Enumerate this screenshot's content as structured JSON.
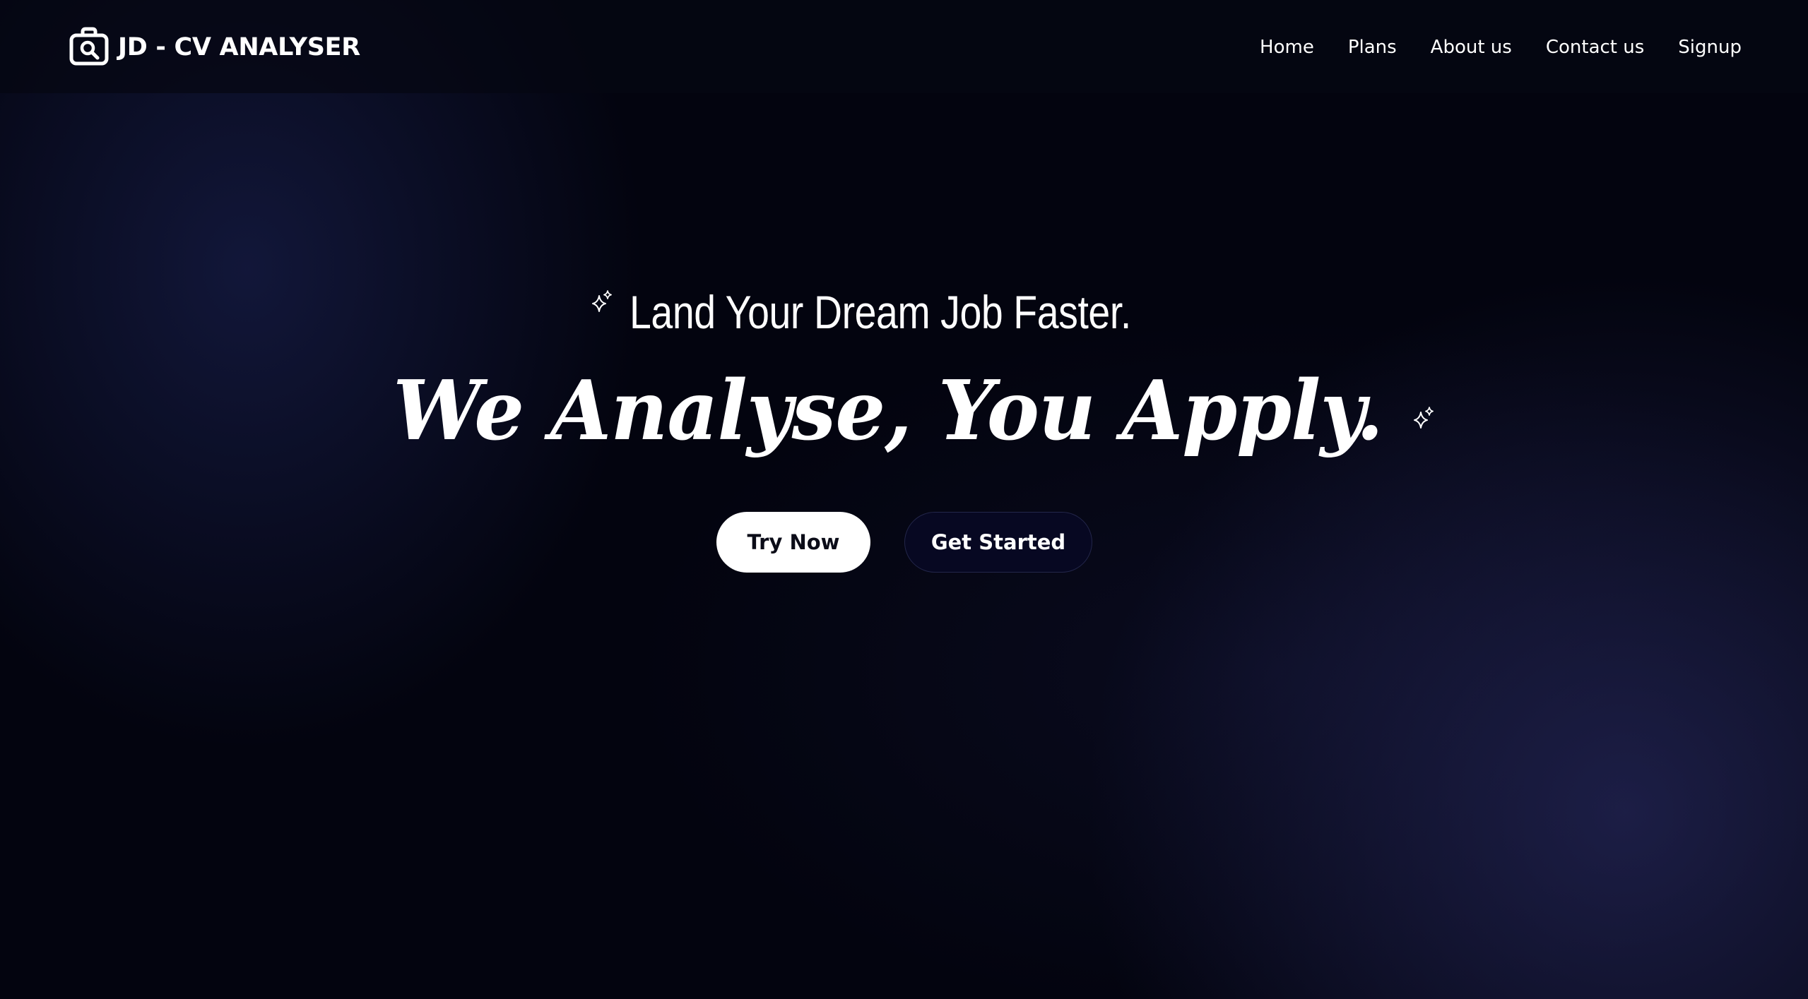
{
  "header": {
    "brand": {
      "name": "JD - CV ANALYSER",
      "icon": "briefcase-search-icon"
    },
    "nav": [
      {
        "label": "Home"
      },
      {
        "label": "Plans"
      },
      {
        "label": "About us"
      },
      {
        "label": "Contact us"
      },
      {
        "label": "Signup"
      }
    ]
  },
  "hero": {
    "tagline": "Land Your Dream Job Faster.",
    "headline": "We Analyse, You Apply.",
    "sparkle_icon": "sparkle-icon",
    "buttons": {
      "primary": "Try Now",
      "secondary": "Get Started"
    }
  },
  "colors": {
    "background": "#03040f",
    "header_background": "#060712",
    "glow": "#2a2c64",
    "primary_button": "#ffffff",
    "secondary_button": "#070822",
    "text": "#ffffff"
  }
}
